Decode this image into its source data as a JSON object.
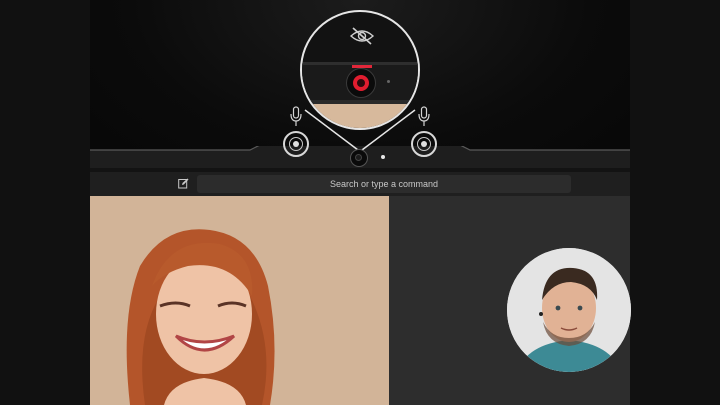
{
  "command_bar": {
    "search_placeholder": "Search or type a command"
  },
  "icons": {
    "privacy": "eye-slash-icon",
    "mic": "microphone-icon",
    "edit": "compose-icon"
  },
  "colors": {
    "shutter_red": "#e11d2f",
    "bezel": "#0b0b0b",
    "command_bar": "#1f1f1f",
    "search_box": "#2c2c2c",
    "panel": "#2d2d2d"
  }
}
